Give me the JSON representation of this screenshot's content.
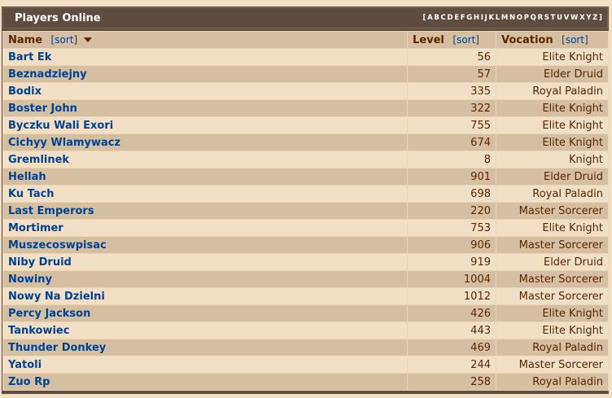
{
  "caption": {
    "title": "Players Online",
    "letters": [
      "[",
      "A",
      "B",
      "C",
      "D",
      "E",
      "F",
      "G",
      "H",
      "I",
      "J",
      "K",
      "L",
      "M",
      "N",
      "O",
      "P",
      "Q",
      "R",
      "S",
      "T",
      "U",
      "V",
      "W",
      "X",
      "Y",
      "Z",
      "]"
    ]
  },
  "headers": {
    "name": "Name",
    "level": "Level",
    "vocation": "Vocation",
    "sort": "[sort]"
  },
  "players": [
    {
      "name": "Bart Ek",
      "level": "56",
      "vocation": "Elite Knight"
    },
    {
      "name": "Beznadziejny",
      "level": "57",
      "vocation": "Elder Druid"
    },
    {
      "name": "Bodix",
      "level": "335",
      "vocation": "Royal Paladin"
    },
    {
      "name": "Boster John",
      "level": "322",
      "vocation": "Elite Knight"
    },
    {
      "name": "Byczku Wali Exori",
      "level": "755",
      "vocation": "Elite Knight"
    },
    {
      "name": "Cichyy Wlamywacz",
      "level": "674",
      "vocation": "Elite Knight"
    },
    {
      "name": "Gremlinek",
      "level": "8",
      "vocation": "Knight"
    },
    {
      "name": "Hellah",
      "level": "901",
      "vocation": "Elder Druid"
    },
    {
      "name": "Ku Tach",
      "level": "698",
      "vocation": "Royal Paladin"
    },
    {
      "name": "Last Emperors",
      "level": "220",
      "vocation": "Master Sorcerer"
    },
    {
      "name": "Mortimer",
      "level": "753",
      "vocation": "Elite Knight"
    },
    {
      "name": "Muszecoswpisac",
      "level": "906",
      "vocation": "Master Sorcerer"
    },
    {
      "name": "Niby Druid",
      "level": "919",
      "vocation": "Elder Druid"
    },
    {
      "name": "Nowiny",
      "level": "1004",
      "vocation": "Master Sorcerer"
    },
    {
      "name": "Nowy Na Dzielni",
      "level": "1012",
      "vocation": "Master Sorcerer"
    },
    {
      "name": "Percy Jackson",
      "level": "426",
      "vocation": "Elite Knight"
    },
    {
      "name": "Tankowiec",
      "level": "443",
      "vocation": "Elite Knight"
    },
    {
      "name": "Thunder Donkey",
      "level": "469",
      "vocation": "Royal Paladin"
    },
    {
      "name": "Yatoli",
      "level": "244",
      "vocation": "Master Sorcerer"
    },
    {
      "name": "Zuo Rp",
      "level": "258",
      "vocation": "Royal Paladin"
    }
  ]
}
